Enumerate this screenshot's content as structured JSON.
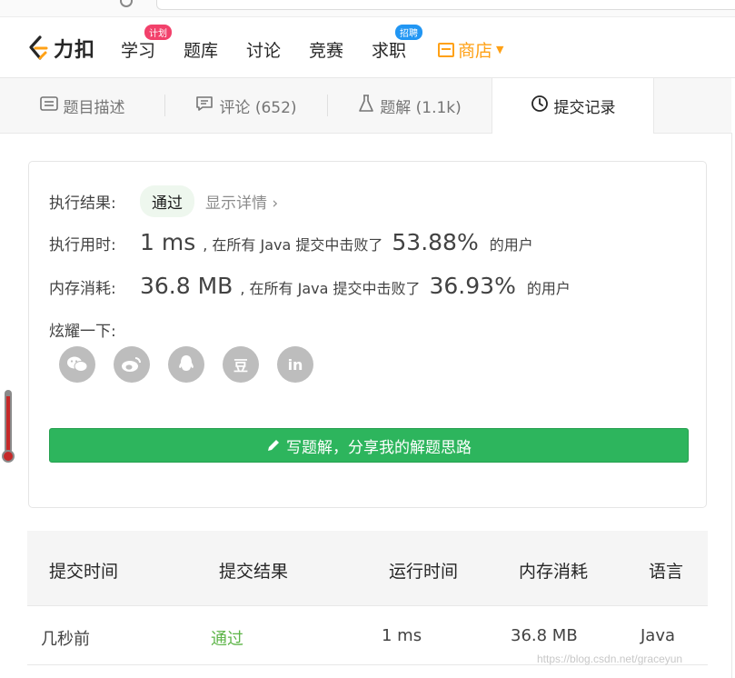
{
  "nav": {
    "logo_text": "力扣",
    "items": [
      {
        "label": "学习",
        "badge": "计划"
      },
      {
        "label": "题库"
      },
      {
        "label": "讨论"
      },
      {
        "label": "竞赛"
      },
      {
        "label": "求职",
        "badge": "招聘"
      }
    ],
    "store_label": "商店",
    "brand_color": "#ffa116"
  },
  "tabs": [
    {
      "label": "题目描述",
      "icon": "description-icon"
    },
    {
      "label": "评论 (652)",
      "icon": "comment-icon"
    },
    {
      "label": "题解 (1.1k)",
      "icon": "flask-icon"
    },
    {
      "label": "提交记录",
      "icon": "clock-icon",
      "active": true
    }
  ],
  "result": {
    "status_label": "执行结果:",
    "status_value": "通过",
    "detail_link": "显示详情",
    "time_label": "执行用时:",
    "time_value": "1 ms",
    "time_mid": ", 在所有 Java 提交中击败了",
    "time_percent": "53.88%",
    "time_suffix": "的用户",
    "mem_label": "内存消耗:",
    "mem_value": "36.8 MB",
    "mem_mid": ", 在所有 Java 提交中击败了",
    "mem_percent": "36.93%",
    "mem_suffix": "的用户",
    "share_label": "炫耀一下:",
    "share_icons": [
      "wechat-icon",
      "weibo-icon",
      "qq-icon",
      "douban-icon",
      "linkedin-icon"
    ],
    "douban_glyph": "豆",
    "linkedin_glyph": "in",
    "write_button": "写题解，分享我的解题思路",
    "success_color": "#2db55d"
  },
  "table": {
    "headers": [
      "提交时间",
      "提交结果",
      "运行时间",
      "内存消耗",
      "语言"
    ],
    "rows": [
      [
        "几秒前",
        "通过",
        "1 ms",
        "36.8 MB",
        "Java"
      ]
    ]
  },
  "watermark": "https://blog.csdn.net/graceyun"
}
